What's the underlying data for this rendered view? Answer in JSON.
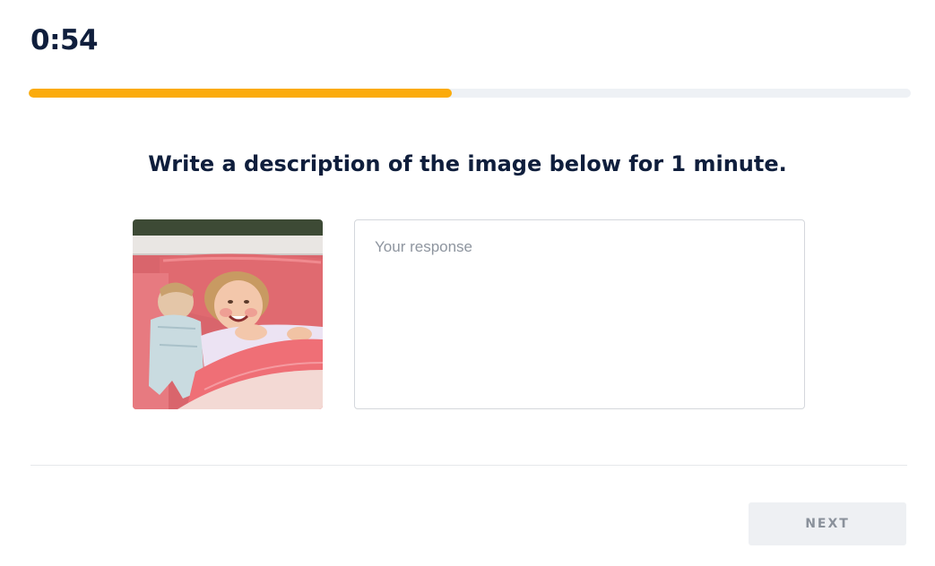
{
  "timer": {
    "value": "0:54"
  },
  "progress": {
    "fraction": 0.48,
    "fill_color": "#fbab0b",
    "track_color": "#eef1f5"
  },
  "prompt": {
    "text": "Write a description of the image below for 1 minute."
  },
  "image": {
    "alt": "photo"
  },
  "response": {
    "value": "",
    "placeholder": "Your response"
  },
  "footer": {
    "next_label": "NEXT",
    "next_enabled": false
  }
}
